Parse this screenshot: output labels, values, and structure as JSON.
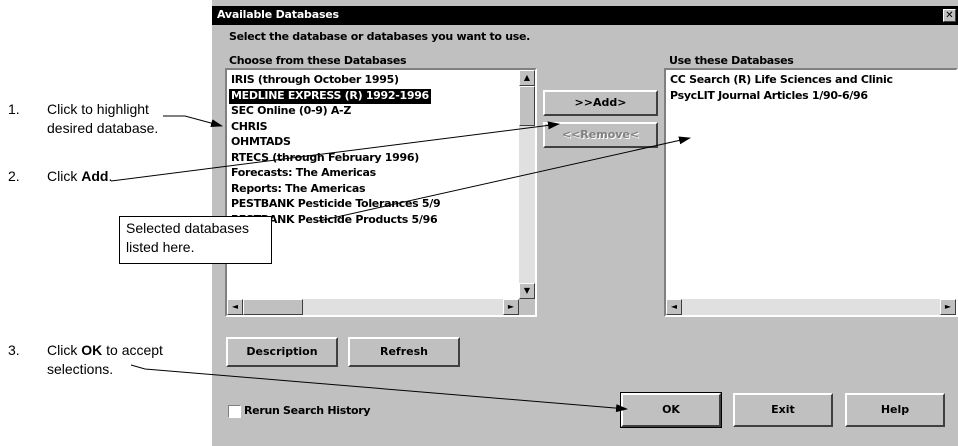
{
  "window": {
    "title": "Available Databases",
    "close_label": "✕"
  },
  "instruction": "Select the database or databases you want to use.",
  "choose_list": {
    "label": "Choose from these Databases",
    "items": [
      "IRIS (through October 1995)",
      "MEDLINE EXPRESS (R) 1992-1996",
      "SEC Online (0-9) A-Z",
      "CHRIS",
      "OHMTADS",
      "RTECS (through February 1996)",
      "Forecasts: The Americas",
      "Reports: The Americas",
      "PESTBANK Pesticide Tolerances 5/9",
      "PESTBANK Pesticide Products 5/96"
    ],
    "selected_index": 1
  },
  "use_list": {
    "label": "Use these Databases",
    "items": [
      "CC Search (R) Life Sciences and Clinic",
      "PsycLIT Journal Articles 1/90-6/96"
    ]
  },
  "buttons": {
    "add": ">>Add>",
    "remove": "<<Remove<",
    "description": "Description",
    "refresh": "Refresh",
    "ok": "OK",
    "exit": "Exit",
    "help": "Help"
  },
  "checkbox": {
    "label": "Rerun Search History",
    "checked": false
  },
  "annotations": {
    "step1_num": "1.",
    "step1_line1": "Click to highlight",
    "step1_line2": "desired database.",
    "step2_num": "2.",
    "step2_pre": "Click ",
    "step2_bold": "Add",
    "step2_post": ".",
    "step3_num": "3.",
    "step3_pre": "Click ",
    "step3_bold": "OK",
    "step3_post": " to accept",
    "step3_line2": "selections.",
    "callout_line1": "Selected databases",
    "callout_line2": "listed here."
  },
  "icons": {
    "scroll_up": "▲",
    "scroll_down": "▼",
    "scroll_left": "◄",
    "scroll_right": "►"
  }
}
